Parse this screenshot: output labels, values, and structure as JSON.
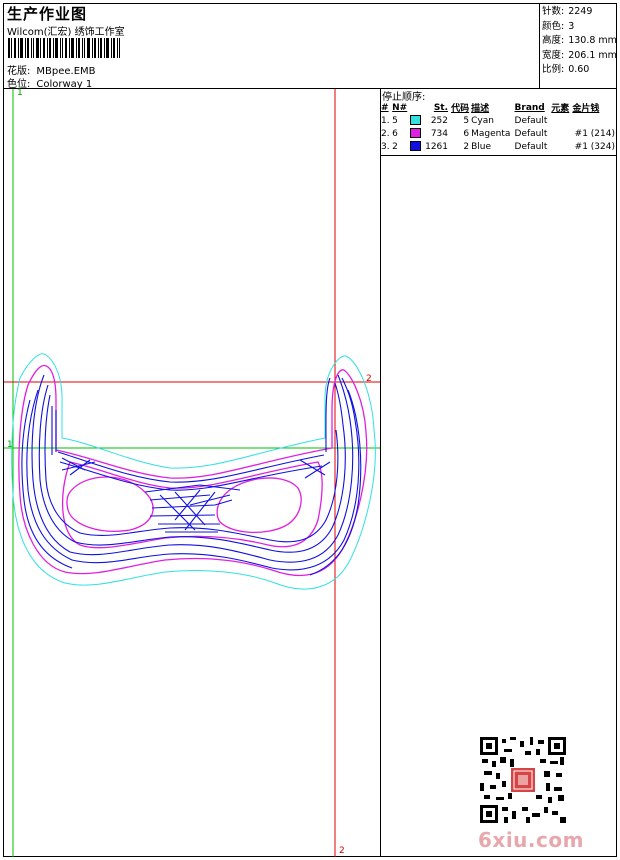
{
  "header": {
    "title": "生产作业图",
    "company": "Wilcom(汇宏) 绣饰工作室",
    "design_label": "花版:",
    "design_value": "MBpee.EMB",
    "colorway_label": "色位:",
    "colorway_value": "Colorway 1"
  },
  "stats": [
    {
      "label": "针数:",
      "value": "2249"
    },
    {
      "label": "颜色:",
      "value": "3"
    },
    {
      "label": "高度:",
      "value": "130.8 mm"
    },
    {
      "label": "宽度:",
      "value": "206.1 mm"
    },
    {
      "label": "比例:",
      "value": "0.60"
    }
  ],
  "stop_sequence": {
    "title": "停止顺序:",
    "headers": [
      "#",
      "N#",
      "St.",
      "代码",
      "描述",
      "Brand",
      "元素",
      "金片钱"
    ],
    "rows": [
      {
        "num": "1.",
        "n": "5",
        "color": "#33e0e0",
        "st": "252",
        "code": "5",
        "desc": "Cyan",
        "brand": "Default",
        "element": "",
        "sequin": ""
      },
      {
        "num": "2.",
        "n": "6",
        "color": "#e020e0",
        "st": "734",
        "code": "6",
        "desc": "Magenta",
        "brand": "Default",
        "element": "",
        "sequin": "#1 (214)"
      },
      {
        "num": "3.",
        "n": "2",
        "color": "#1010e0",
        "st": "1261",
        "code": "2",
        "desc": "Blue",
        "brand": "Default",
        "element": "",
        "sequin": "#1 (324)"
      }
    ]
  },
  "canvas_markers": {
    "v1_top": "1",
    "h1_left": "1",
    "h2_right": "2",
    "v2_bottom": "2"
  },
  "colors": {
    "cyan": "#33e0e0",
    "magenta": "#e020e0",
    "blue": "#1010e0",
    "guide_red": "#e00000",
    "guide_green": "#00c000"
  },
  "watermark": "6xiu.com"
}
